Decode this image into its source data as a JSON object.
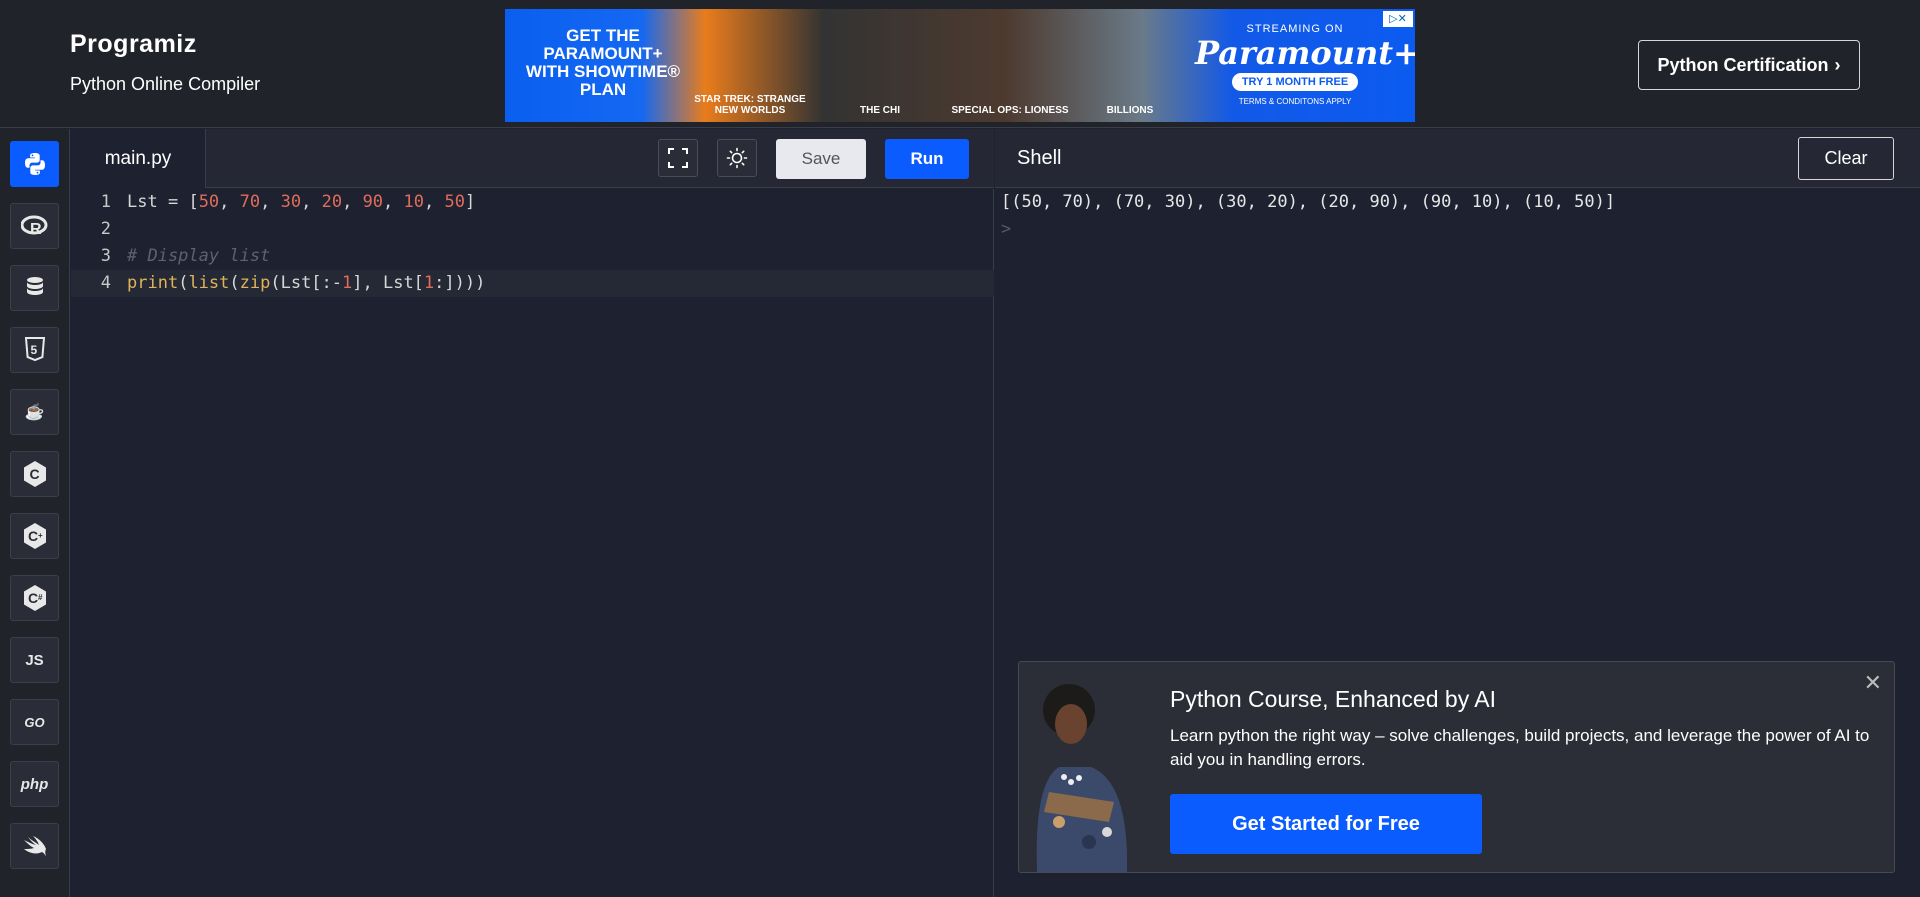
{
  "header": {
    "logo": "Programiz",
    "subtitle": "Python Online Compiler",
    "cert_button": "Python Certification",
    "cert_chevron": "›"
  },
  "ad": {
    "headline": "GET THE PARAMOUNT+ WITH SHOWTIME® PLAN",
    "captions": [
      "STAR TREK: STRANGE NEW WORLDS",
      "THE CHI",
      "SPECIAL OPS: LIONESS",
      "BILLIONS"
    ],
    "streaming": "STREAMING ON",
    "brand": "Paramount+",
    "cta": "TRY 1 MONTH FREE",
    "terms": "TERMS & CONDITONS APPLY"
  },
  "sidebar": {
    "items": [
      {
        "name": "python",
        "label": ""
      },
      {
        "name": "r",
        "label": "R"
      },
      {
        "name": "sql",
        "label": ""
      },
      {
        "name": "html",
        "label": "5"
      },
      {
        "name": "java",
        "label": "☕"
      },
      {
        "name": "c",
        "label": "C"
      },
      {
        "name": "cpp",
        "label": "C"
      },
      {
        "name": "csharp",
        "label": "C"
      },
      {
        "name": "js",
        "label": "JS"
      },
      {
        "name": "go",
        "label": "GO"
      },
      {
        "name": "php",
        "label": "php"
      },
      {
        "name": "swift",
        "label": ""
      }
    ]
  },
  "editor": {
    "filename": "main.py",
    "save_label": "Save",
    "run_label": "Run",
    "line_numbers": [
      "1",
      "2",
      "3",
      "4"
    ]
  },
  "shell": {
    "title": "Shell",
    "clear_label": "Clear",
    "output": "[(50, 70), (70, 30), (30, 20), (20, 90), (90, 10), (10, 50)]",
    "prompt": ">"
  },
  "promo": {
    "title": "Python Course, Enhanced by AI",
    "description": "Learn python the right way – solve challenges, build projects, and leverage the power of AI to aid you in handling errors.",
    "button": "Get Started for Free",
    "close": "✕"
  },
  "colors": {
    "accent": "#0b5cff",
    "background": "#1e2130",
    "number": "#e06c5a",
    "builtin": "#e0b45a",
    "comment": "#5c6370"
  }
}
